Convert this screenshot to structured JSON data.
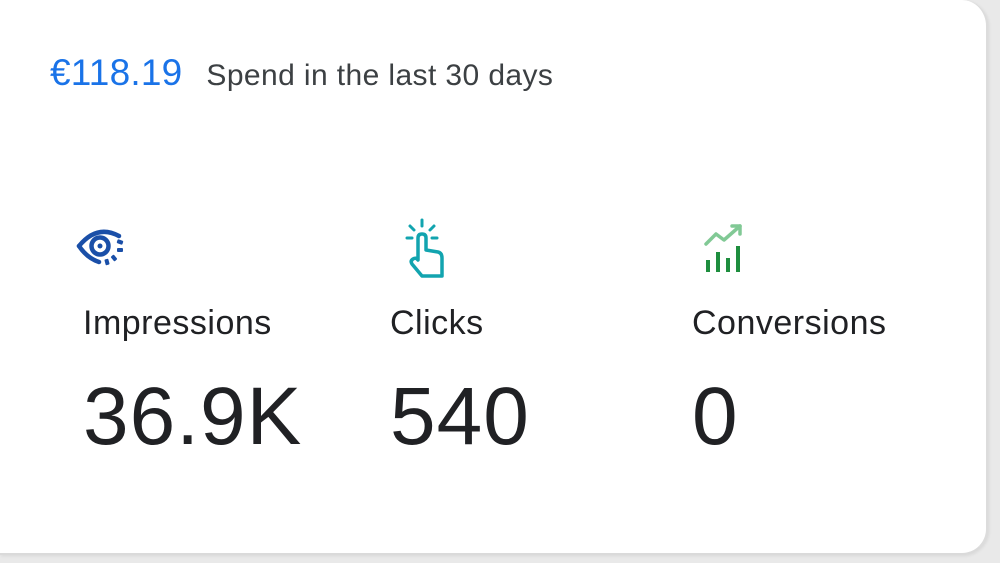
{
  "spend": {
    "amount": "€118.19",
    "label": "Spend in the last 30 days"
  },
  "metrics": [
    {
      "label": "Impressions",
      "value": "36.9K",
      "icon": "eye-icon",
      "color": "#1a4fa8"
    },
    {
      "label": "Clicks",
      "value": "540",
      "icon": "tap-finger-icon",
      "color": "#12a4af"
    },
    {
      "label": "Conversions",
      "value": "0",
      "icon": "trending-up-chart-icon",
      "color": "#1e8e3e"
    }
  ],
  "colors": {
    "accent": "#1a73e8",
    "text": "#202124",
    "secondary_text": "#3c4043"
  }
}
